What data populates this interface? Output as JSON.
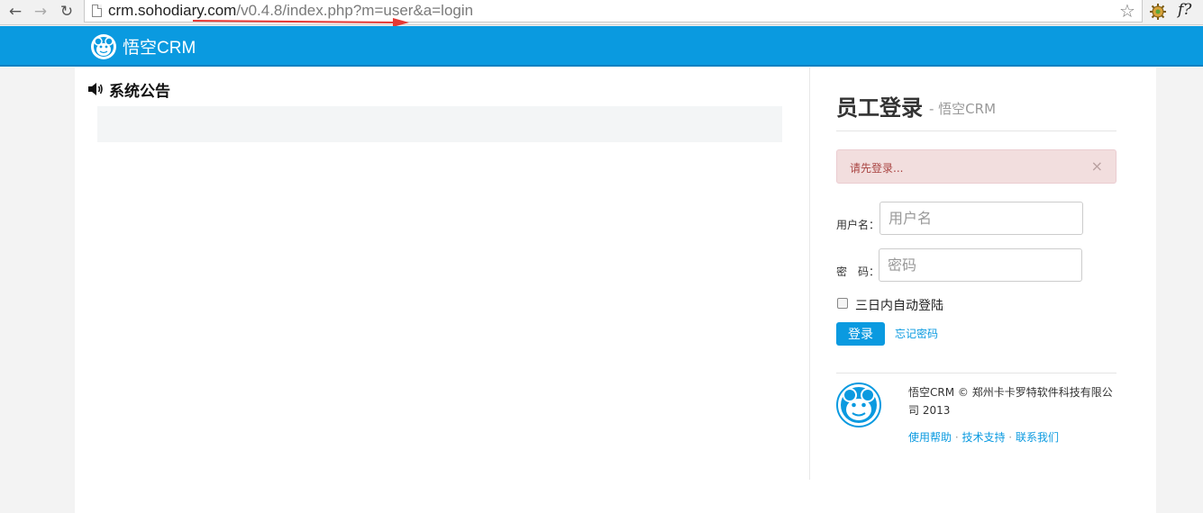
{
  "browser": {
    "url_host": "crm.sohodiary.com",
    "url_path": "/v0.4.8/index.php?m=user&a=login",
    "back_icon": "back-arrow-icon",
    "forward_icon": "forward-arrow-icon",
    "reload_icon": "reload-icon",
    "bookmark_icon": "star-icon",
    "fx_label": "f?"
  },
  "navbar": {
    "brand": "悟空CRM",
    "brand_icon": "monkey-logo-icon",
    "color": "#0a9ae0"
  },
  "notice": {
    "title": "系统公告",
    "icon": "speaker-icon",
    "items": []
  },
  "login": {
    "title": "员工登录",
    "subtitle": "- 悟空CRM",
    "alert": {
      "text": "请先登录...",
      "close": "×"
    },
    "username": {
      "label": "用户名：",
      "placeholder": "用户名",
      "value": ""
    },
    "password": {
      "label": "密　码：",
      "placeholder": "密码",
      "value": ""
    },
    "remember": {
      "label": "三日内自动登陆",
      "checked": false
    },
    "submit_label": "登录",
    "forgot_label": "忘记密码"
  },
  "footer": {
    "copyright": "悟空CRM © 郑州卡卡罗特软件科技有限公司 2013",
    "links": [
      "使用帮助",
      "技术支持",
      "联系我们"
    ],
    "separator": " · "
  }
}
